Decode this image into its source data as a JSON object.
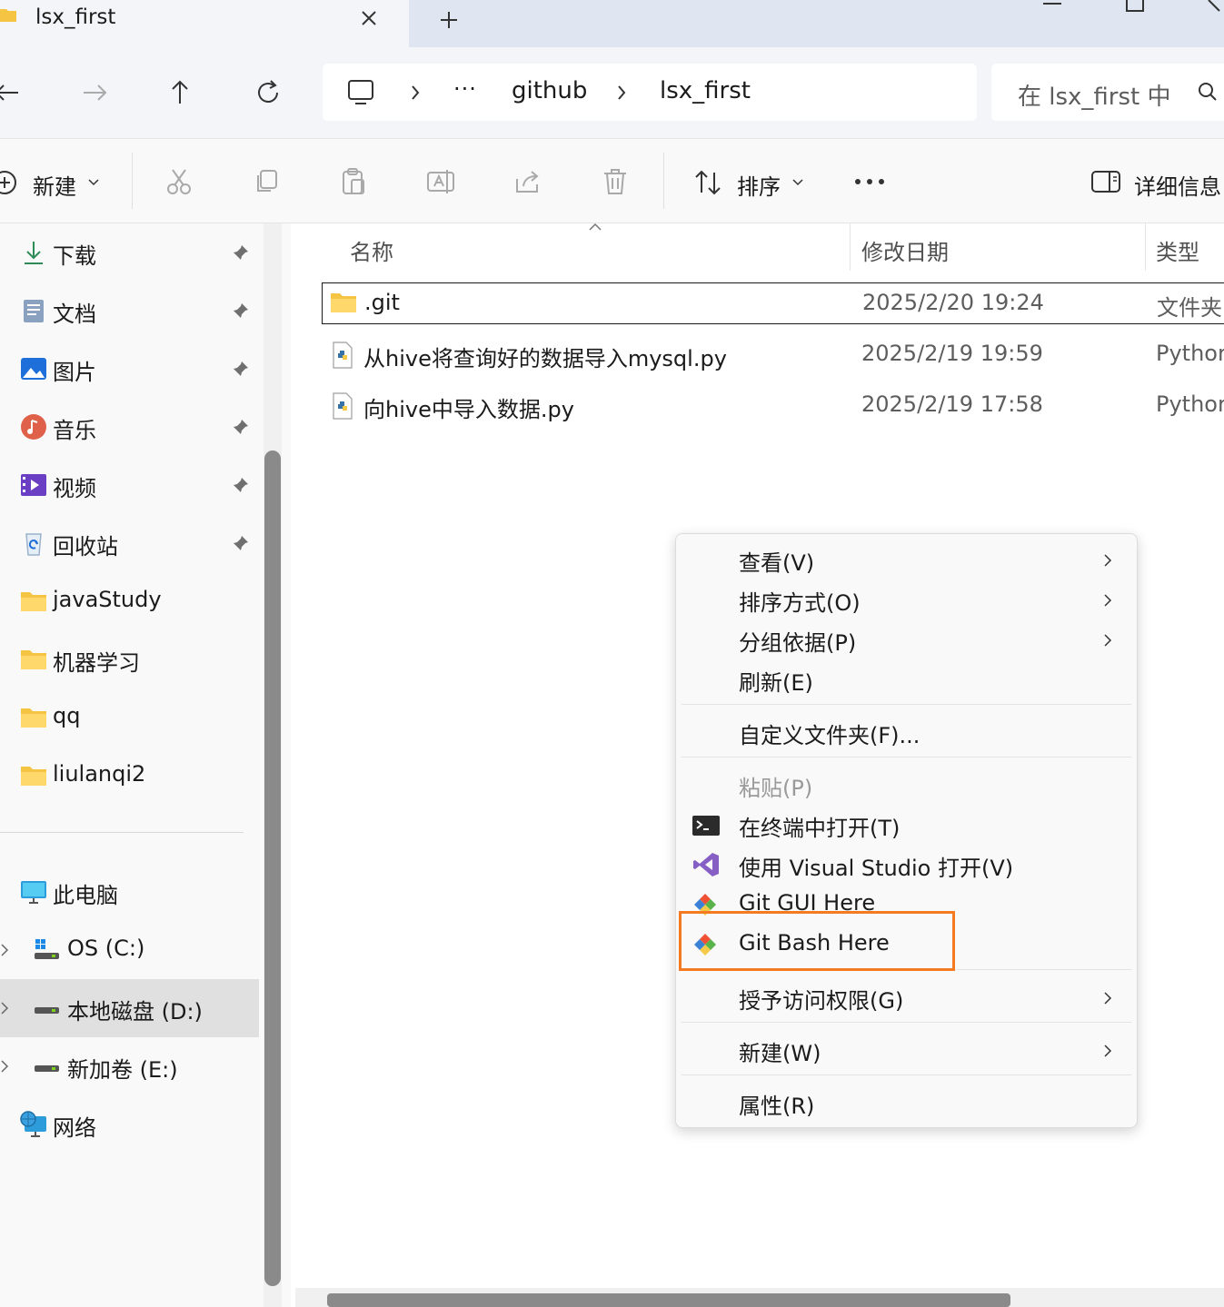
{
  "tab": {
    "title": "lsx_first",
    "close_label": "close",
    "new_tab_label": "new tab"
  },
  "address": {
    "breadcrumbs": [
      "github",
      "lsx_first"
    ],
    "more": "···",
    "search_placeholder": "在 lsx_first 中"
  },
  "toolbar": {
    "new_label": "新建",
    "sort_label": "排序",
    "more_label": "•••",
    "details_label": "详细信息",
    "icons": [
      "cut-icon",
      "copy-icon",
      "paste-icon",
      "rename-icon",
      "share-icon",
      "delete-icon"
    ]
  },
  "sidebar": {
    "quick_access": [
      {
        "label": "下载",
        "icon": "download-icon",
        "pinned": true
      },
      {
        "label": "文档",
        "icon": "documents-icon",
        "pinned": true
      },
      {
        "label": "图片",
        "icon": "pictures-icon",
        "pinned": true
      },
      {
        "label": "音乐",
        "icon": "music-icon",
        "pinned": true
      },
      {
        "label": "视频",
        "icon": "videos-icon",
        "pinned": true
      },
      {
        "label": "回收站",
        "icon": "recycle-bin-icon",
        "pinned": true
      },
      {
        "label": "javaStudy",
        "icon": "folder-icon",
        "pinned": false
      },
      {
        "label": "机器学习",
        "icon": "folder-icon",
        "pinned": false
      },
      {
        "label": "qq",
        "icon": "folder-icon",
        "pinned": false
      },
      {
        "label": "liulanqi2",
        "icon": "folder-icon",
        "pinned": false
      }
    ],
    "this_pc": "此电脑",
    "drives": [
      {
        "label": "OS (C:)",
        "selected": false
      },
      {
        "label": "本地磁盘 (D:)",
        "selected": true
      },
      {
        "label": "新加卷 (E:)",
        "selected": false
      }
    ],
    "network": "网络"
  },
  "filelist": {
    "columns": {
      "name": "名称",
      "date": "修改日期",
      "type": "类型"
    },
    "rows": [
      {
        "name": ".git",
        "date": "2025/2/20 19:24",
        "type": "文件夹",
        "icon": "folder-icon",
        "selected": true
      },
      {
        "name": "从hive将查询好的数据导入mysql.py",
        "date": "2025/2/19 19:59",
        "type": "Pythor",
        "icon": "python-file-icon",
        "selected": false
      },
      {
        "name": "向hive中导入数据.py",
        "date": "2025/2/19 17:58",
        "type": "Pythor",
        "icon": "python-file-icon",
        "selected": false
      }
    ]
  },
  "context_menu": {
    "items": [
      {
        "label": "查看(V)",
        "submenu": true
      },
      {
        "label": "排序方式(O)",
        "submenu": true
      },
      {
        "label": "分组依据(P)",
        "submenu": true
      },
      {
        "label": "刷新(E)",
        "submenu": false
      },
      {
        "label": "自定义文件夹(F)...",
        "submenu": false
      },
      {
        "label": "粘贴(P)",
        "submenu": false,
        "disabled": true
      },
      {
        "label": "在终端中打开(T)",
        "submenu": false,
        "icon": "terminal-icon"
      },
      {
        "label": "使用 Visual Studio 打开(V)",
        "submenu": false,
        "icon": "visual-studio-icon"
      },
      {
        "label": "Git GUI Here",
        "submenu": false,
        "icon": "git-gui-icon"
      },
      {
        "label": "Git Bash Here",
        "submenu": false,
        "icon": "git-bash-icon",
        "highlighted": true
      },
      {
        "label": "授予访问权限(G)",
        "submenu": true
      },
      {
        "label": "新建(W)",
        "submenu": true
      },
      {
        "label": "属性(R)",
        "submenu": false
      }
    ]
  },
  "colors": {
    "highlight_border": "#f57b22",
    "folder": "#f6c443",
    "selected_drive_bg": "#e0e0e0"
  }
}
